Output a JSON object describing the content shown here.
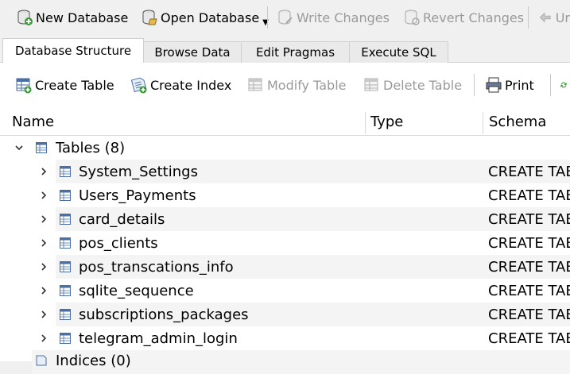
{
  "main_toolbar": {
    "new_database": "New Database",
    "open_database": "Open Database",
    "write_changes": "Write Changes",
    "revert_changes": "Revert Changes",
    "undo_partial": "Ur"
  },
  "tabs": [
    {
      "label": "Database Structure",
      "active": true
    },
    {
      "label": "Browse Data",
      "active": false
    },
    {
      "label": "Edit Pragmas",
      "active": false
    },
    {
      "label": "Execute SQL",
      "active": false
    }
  ],
  "structure_toolbar": {
    "create_table": "Create Table",
    "create_index": "Create Index",
    "modify_table": "Modify Table",
    "delete_table": "Delete Table",
    "print": "Print"
  },
  "tree": {
    "columns": {
      "name": "Name",
      "type": "Type",
      "schema": "Schema"
    },
    "group": {
      "label": "Tables (8)"
    },
    "tables": [
      {
        "name": "System_Settings",
        "schema": "CREATE TABLE"
      },
      {
        "name": "Users_Payments",
        "schema": "CREATE TABLE"
      },
      {
        "name": "card_details",
        "schema": "CREATE TABLE"
      },
      {
        "name": "pos_clients",
        "schema": "CREATE TABLE"
      },
      {
        "name": "pos_transcations_info",
        "schema": "CREATE TABLE"
      },
      {
        "name": "sqlite_sequence",
        "schema": "CREATE TABLE"
      },
      {
        "name": "subscriptions_packages",
        "schema": "CREATE TABLE"
      },
      {
        "name": "telegram_admin_login",
        "schema": "CREATE TABLE"
      }
    ],
    "indices_group": {
      "label": "Indices (0)"
    }
  },
  "colors": {
    "accent_green": "#3a9a3a",
    "icon_blue": "#4a6fa5",
    "disabled_text": "#9a9a9a"
  }
}
